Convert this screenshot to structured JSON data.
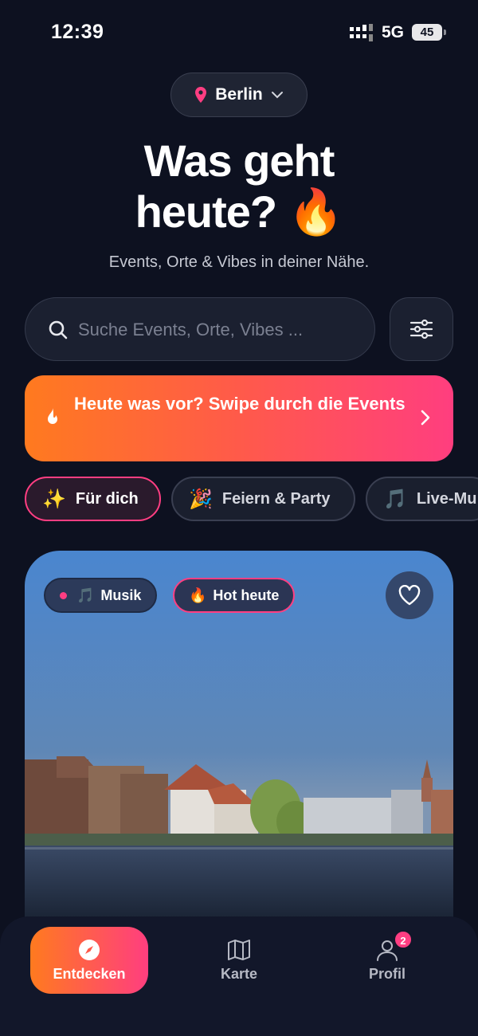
{
  "status_bar": {
    "time": "12:39",
    "network": "5G",
    "battery": "45"
  },
  "location": {
    "city": "Berlin",
    "icon": "map-pin-icon"
  },
  "hero": {
    "title_line1": "Was geht",
    "title_line2": "heute? 🔥",
    "subtitle": "Events, Orte & Vibes in deiner Nähe."
  },
  "search": {
    "placeholder": "Suche Events, Orte, Vibes ...",
    "value": ""
  },
  "banner": {
    "text": "Heute was vor? Swipe durch die Events",
    "icon": "flame-icon"
  },
  "categories": [
    {
      "emoji": "✨",
      "label": "Für dich",
      "active": true
    },
    {
      "emoji": "🎉",
      "label": "Feiern & Party",
      "active": false
    },
    {
      "emoji": "🎵",
      "label": "Live-Mu",
      "active": false
    }
  ],
  "event_card": {
    "tags": [
      {
        "emoji": "🎵",
        "label": "Musik"
      },
      {
        "emoji": "🔥",
        "label": "Hot heute"
      }
    ],
    "favorite_icon": "heart-icon"
  },
  "bottom_nav": [
    {
      "label": "Entdecken",
      "icon": "compass-icon",
      "active": true
    },
    {
      "label": "Karte",
      "icon": "map-icon",
      "active": false
    },
    {
      "label": "Profil",
      "icon": "user-icon",
      "active": false,
      "badge": "2"
    }
  ],
  "colors": {
    "background": "#0d1120",
    "accent_orange": "#ff7a1f",
    "accent_pink": "#ff3e7f"
  }
}
